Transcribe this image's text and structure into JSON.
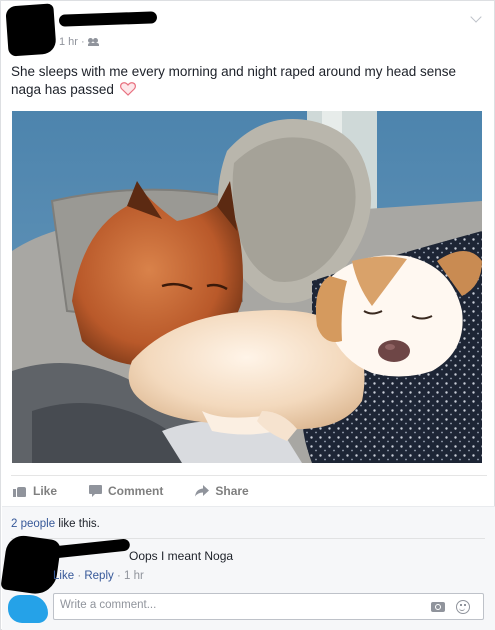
{
  "post": {
    "time": "1 hr",
    "audience_icon": "friends-icon",
    "text": "She sleeps with me every morning and night raped around my head sense naga has passed",
    "emoji": "heart-icon"
  },
  "actions": {
    "like": "Like",
    "comment": "Comment",
    "share": "Share"
  },
  "likes": {
    "people": "2 people",
    "suffix": " like this."
  },
  "comment": {
    "text": "Oops I meant Noga",
    "like": "Like",
    "reply": "Reply",
    "time": "1 hr"
  },
  "composer": {
    "placeholder": "Write a comment..."
  },
  "colors": {
    "link": "#365899",
    "meta": "#90949c",
    "avatar_blue": "#25a2e8"
  }
}
